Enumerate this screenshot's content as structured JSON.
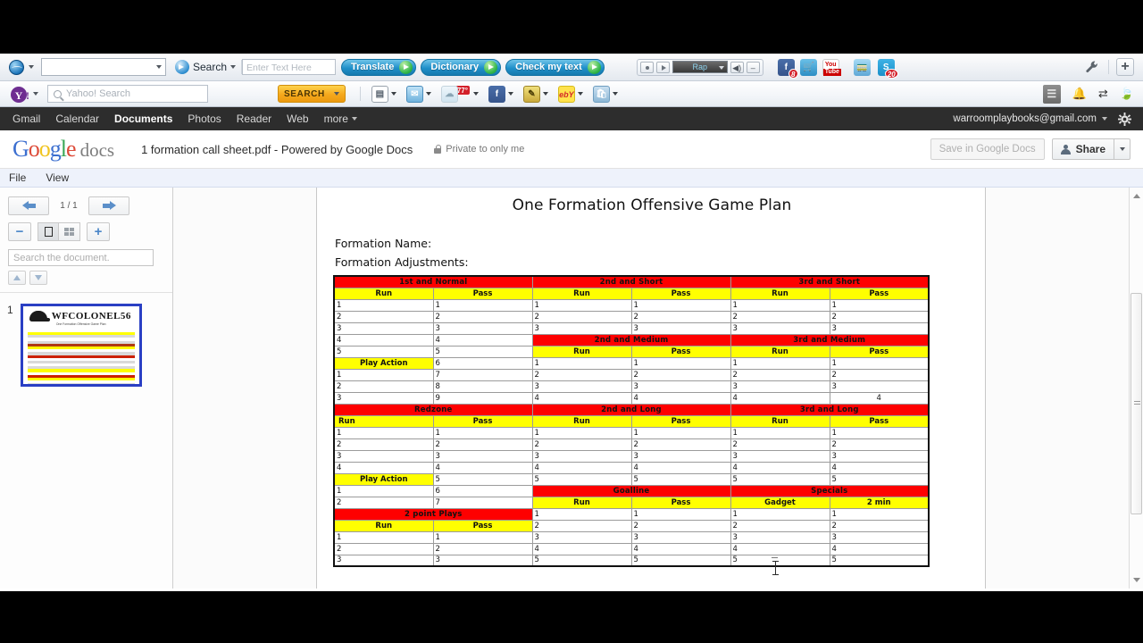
{
  "browser": {
    "translate_toolbar": {
      "search_label": "Search",
      "enter_text_placeholder": "Enter Text Here",
      "buttons": [
        "Translate",
        "Dictionary",
        "Check my text"
      ],
      "player_preset": "Rap",
      "icons": [
        "globe-icon",
        "search-arrow-icon",
        "facebook-icon",
        "shopping-cart-icon",
        "youtube-icon",
        "train-icon",
        "skype-icon",
        "wrench-icon",
        "plus-icon"
      ],
      "badges": {
        "facebook": "8",
        "skype": "20"
      }
    },
    "yahoo_toolbar": {
      "search_placeholder": "Yahoo! Search",
      "search_button": "SEARCH",
      "weather_temp": "77°",
      "icons": [
        "yahoo-icon",
        "page-icon",
        "mail-icon",
        "weather-icon",
        "facebook-icon",
        "notepad-icon",
        "ebay-icon",
        "shopping-icon",
        "list-icon",
        "bell-icon",
        "transfer-icon",
        "leaf-icon"
      ]
    }
  },
  "gbar": {
    "links": [
      "Gmail",
      "Calendar",
      "Documents",
      "Photos",
      "Reader",
      "Web"
    ],
    "active": "Documents",
    "more": "more",
    "account": "warroomplaybooks@gmail.com",
    "gear_icon": "gear-icon"
  },
  "docs_header": {
    "logo": {
      "g1": "G",
      "o1": "o",
      "o2": "o",
      "g2": "g",
      "l": "l",
      "e": "e",
      "suffix": "docs"
    },
    "document_title": "1 formation call sheet.pdf - Powered by Google Docs",
    "privacy": "Private to only me",
    "save_button": "Save in Google Docs",
    "share_button": "Share"
  },
  "viewer_menu": {
    "items": [
      "File",
      "View"
    ]
  },
  "viewer_tools": {
    "page_indicator": "1 / 1",
    "zoom_out": "−",
    "zoom_in": "+",
    "search_placeholder": "Search the document.",
    "prev_icon": "arrow-left-icon",
    "next_icon": "arrow-right-icon",
    "single_page_icon": "single-page-view-icon",
    "grid_page_icon": "grid-page-view-icon",
    "find_prev_icon": "triangle-up-icon",
    "find_next_icon": "triangle-down-icon"
  },
  "thumbnail": {
    "number": "1",
    "title": "WFCOLONEL56",
    "subtitle": "One Formation Offensive Game Plan"
  },
  "document": {
    "title": "One Formation Offensive Game Plan",
    "field_1": "Formation Name:",
    "field_2": "Formation Adjustments:",
    "labels": {
      "run": "Run",
      "pass": "Pass",
      "play_action": "Play Action",
      "gadget": "Gadget",
      "two_min": "2 min"
    },
    "sections": {
      "s1": "1st and Normal",
      "s2": "2nd and Short",
      "s3": "3rd and Short",
      "s4": "2nd and Medium",
      "s5": "3rd and Medium",
      "s6": "Redzone",
      "s7": "2nd and Long",
      "s8": "3rd and Long",
      "s9": "Goalline",
      "s10": "Specials",
      "s11": "2 point Plays"
    },
    "numbers": {
      "n1": "1",
      "n2": "2",
      "n3": "3",
      "n4": "4",
      "n5": "5",
      "n6": "6",
      "n7": "7",
      "n8": "8",
      "n9": "9"
    }
  }
}
